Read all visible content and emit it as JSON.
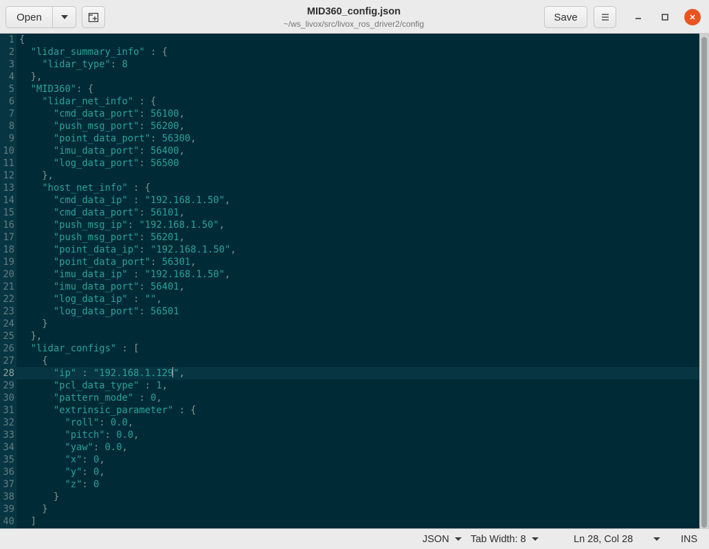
{
  "header": {
    "open_label": "Open",
    "title": "MID360_config.json",
    "subtitle": "~/ws_livox/src/livox_ros_driver2/config",
    "save_label": "Save",
    "icons": {
      "open_menu": "chevron-down-icon",
      "new_tab": "new-tab-icon",
      "main_menu": "hamburger-menu-icon",
      "minimize": "minimize-icon",
      "maximize": "maximize-icon",
      "close": "close-icon"
    },
    "close_color": "#e95420"
  },
  "editor": {
    "theme_background": "#002b36",
    "current_line": 28,
    "lines": [
      {
        "n": "1",
        "text": "{"
      },
      {
        "n": "2",
        "text": "  \"lidar_summary_info\" : {"
      },
      {
        "n": "3",
        "text": "    \"lidar_type\": 8"
      },
      {
        "n": "4",
        "text": "  },"
      },
      {
        "n": "5",
        "text": "  \"MID360\": {"
      },
      {
        "n": "6",
        "text": "    \"lidar_net_info\" : {"
      },
      {
        "n": "7",
        "text": "      \"cmd_data_port\": 56100,"
      },
      {
        "n": "8",
        "text": "      \"push_msg_port\": 56200,"
      },
      {
        "n": "9",
        "text": "      \"point_data_port\": 56300,"
      },
      {
        "n": "10",
        "text": "      \"imu_data_port\": 56400,"
      },
      {
        "n": "11",
        "text": "      \"log_data_port\": 56500"
      },
      {
        "n": "12",
        "text": "    },"
      },
      {
        "n": "13",
        "text": "    \"host_net_info\" : {"
      },
      {
        "n": "14",
        "text": "      \"cmd_data_ip\" : \"192.168.1.50\","
      },
      {
        "n": "15",
        "text": "      \"cmd_data_port\": 56101,"
      },
      {
        "n": "16",
        "text": "      \"push_msg_ip\": \"192.168.1.50\","
      },
      {
        "n": "17",
        "text": "      \"push_msg_port\": 56201,"
      },
      {
        "n": "18",
        "text": "      \"point_data_ip\": \"192.168.1.50\","
      },
      {
        "n": "19",
        "text": "      \"point_data_port\": 56301,"
      },
      {
        "n": "20",
        "text": "      \"imu_data_ip\" : \"192.168.1.50\","
      },
      {
        "n": "21",
        "text": "      \"imu_data_port\": 56401,"
      },
      {
        "n": "22",
        "text": "      \"log_data_ip\" : \"\","
      },
      {
        "n": "23",
        "text": "      \"log_data_port\": 56501"
      },
      {
        "n": "24",
        "text": "    }"
      },
      {
        "n": "25",
        "text": "  },"
      },
      {
        "n": "26",
        "text": "  \"lidar_configs\" : ["
      },
      {
        "n": "27",
        "text": "    {"
      },
      {
        "n": "28",
        "text": "      \"ip\" : \"192.168.1.129\","
      },
      {
        "n": "29",
        "text": "      \"pcl_data_type\" : 1,"
      },
      {
        "n": "30",
        "text": "      \"pattern_mode\" : 0,"
      },
      {
        "n": "31",
        "text": "      \"extrinsic_parameter\" : {"
      },
      {
        "n": "32",
        "text": "        \"roll\": 0.0,"
      },
      {
        "n": "33",
        "text": "        \"pitch\": 0.0,"
      },
      {
        "n": "34",
        "text": "        \"yaw\": 0.0,"
      },
      {
        "n": "35",
        "text": "        \"x\": 0,"
      },
      {
        "n": "36",
        "text": "        \"y\": 0,"
      },
      {
        "n": "37",
        "text": "        \"z\": 0"
      },
      {
        "n": "38",
        "text": "      }"
      },
      {
        "n": "39",
        "text": "    }"
      },
      {
        "n": "40",
        "text": "  ]"
      }
    ]
  },
  "statusbar": {
    "language": "JSON",
    "tab_width": "Tab Width: 8",
    "position": "Ln 28, Col 28",
    "mode": "INS"
  }
}
